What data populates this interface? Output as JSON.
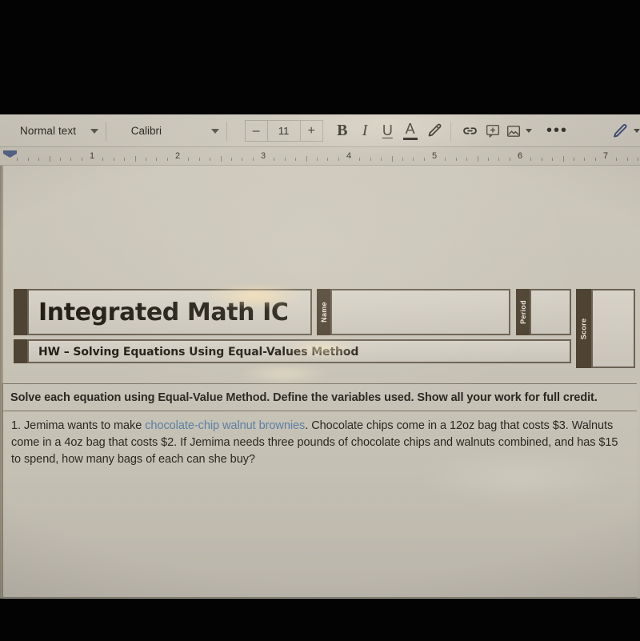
{
  "toolbar": {
    "paragraph_style": "Normal text",
    "font_name": "Calibri",
    "font_size": "11",
    "decrease_size_label": "–",
    "increase_size_label": "+",
    "bold_label": "B",
    "italic_label": "I",
    "underline_label": "U",
    "text_color_label": "A",
    "highlight_icon": "highlighter-pen-icon",
    "link_icon": "link-icon",
    "comment_icon": "add-comment-icon",
    "image_icon": "insert-image-icon",
    "more_label": "•••",
    "edit_mode_icon": "edit-pencil-icon"
  },
  "ruler": {
    "numbers": [
      "1",
      "2",
      "3",
      "4",
      "5",
      "6",
      "7"
    ]
  },
  "document": {
    "header": {
      "title": "Integrated Math IC",
      "subtitle": "HW – Solving Equations Using Equal-Values Method",
      "name_label": "Name",
      "period_label": "Period",
      "score_label": "Score",
      "name_value": "",
      "period_value": "",
      "score_value": ""
    },
    "instructions": "Solve each equation using Equal-Value Method. Define the variables used. Show all your work for full credit.",
    "problem": {
      "number": "1.",
      "text_before_link": " Jemima wants to make ",
      "link_text": "chocolate-chip walnut brownies",
      "text_after_link": ". Chocolate chips come in a 12oz bag that costs $3. Walnuts come in a 4oz bag that costs $2. If Jemima needs three pounds of chocolate chips and walnuts combined, and has $15 to spend, how many bags of each can she buy?"
    }
  },
  "colors": {
    "link": "#5b7fa3",
    "header_tab": "#4f4334",
    "paper": "#c9c4b8",
    "letterbox": "#030303"
  }
}
